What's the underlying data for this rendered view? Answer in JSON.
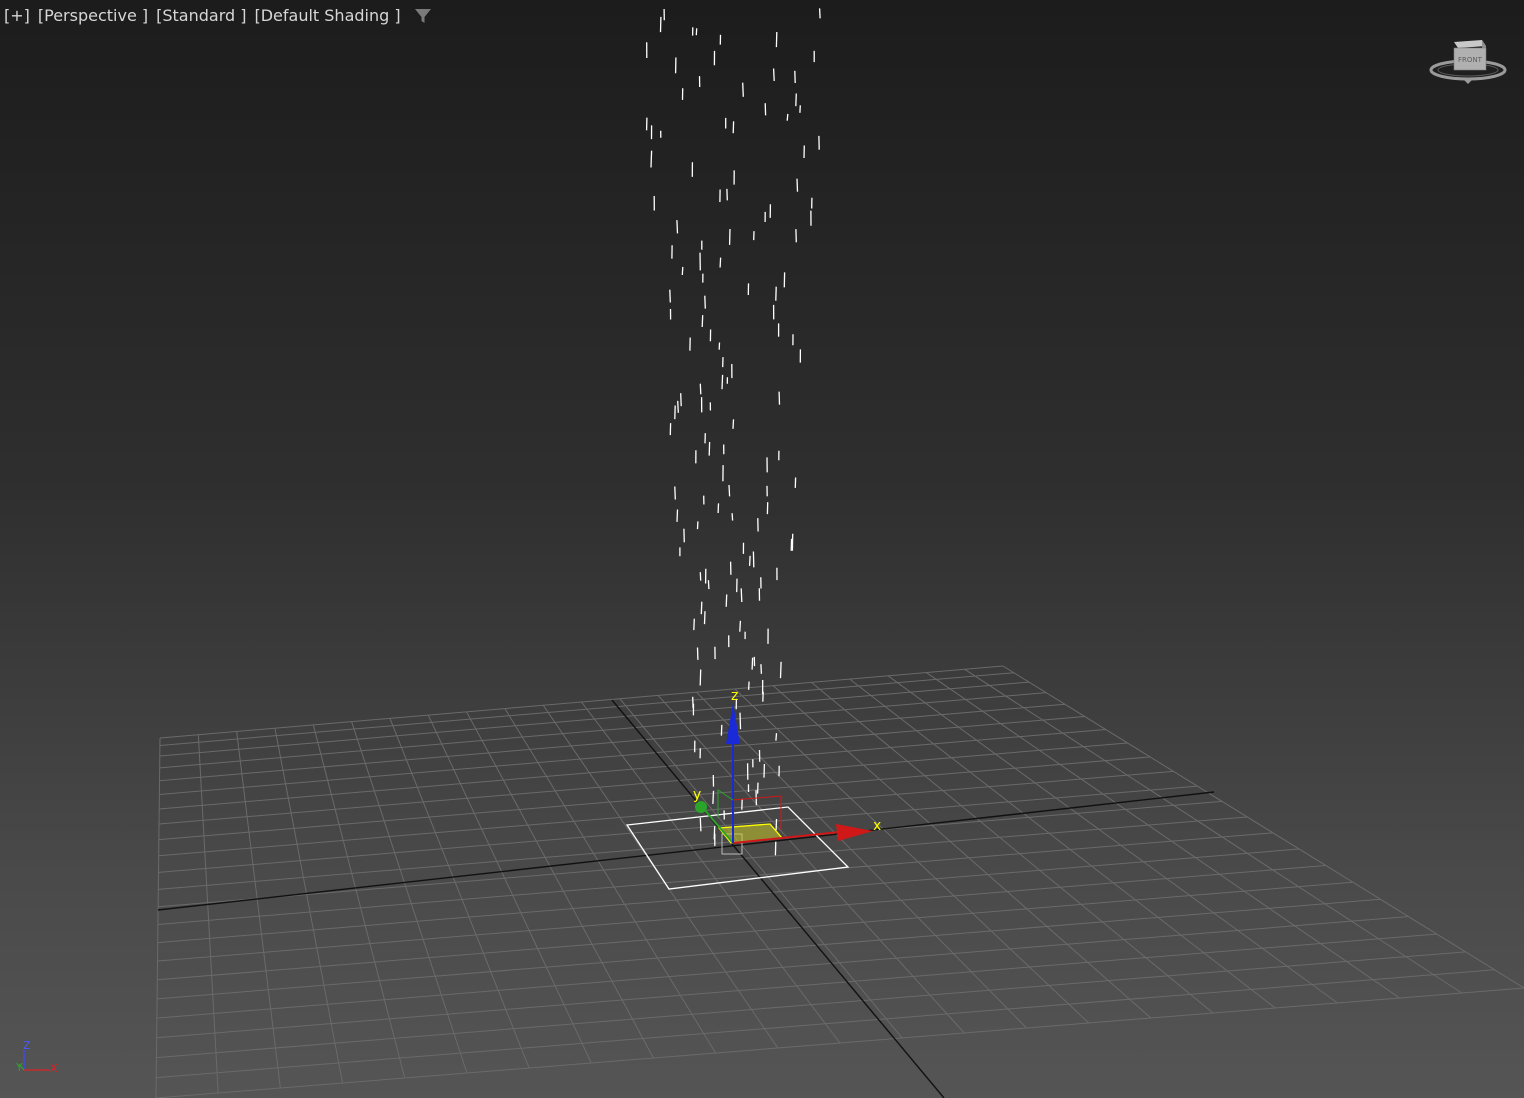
{
  "viewport_labels": {
    "menu": "[+]",
    "view": "[Perspective ]",
    "mode": "[Standard ]",
    "shading": "[Default Shading ]"
  },
  "viewcube": {
    "face_label": "FRONT"
  },
  "gizmo": {
    "x_label": "x",
    "y_label": "y",
    "z_label": "z"
  },
  "world_axis": {
    "z_label": "Z",
    "y_label": "Y",
    "x_label": "X"
  },
  "colors": {
    "axis_x": "#d01818",
    "axis_y": "#2aa52a",
    "axis_z": "#1a2ad8",
    "gizmo_label": "#ffff00",
    "grid": "#6a6a6a",
    "particle": "#ffffff",
    "emitter": "#ffffff"
  },
  "icons": [
    "filter-icon",
    "viewcube-icon",
    "world-axis-icon",
    "transform-gizmo-icon"
  ]
}
